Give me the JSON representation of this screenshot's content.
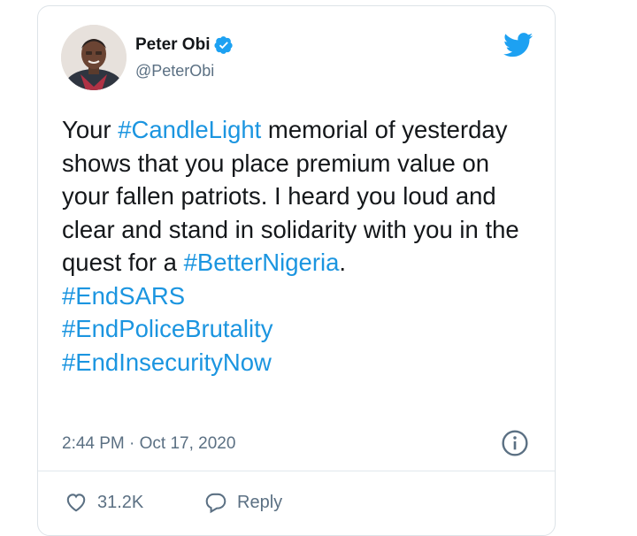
{
  "tweet": {
    "author_name": "Peter Obi",
    "author_handle": "@PeterObi",
    "text_segments": [
      {
        "text": "Your ",
        "type": "text"
      },
      {
        "text": "#CandleLight",
        "type": "hashtag"
      },
      {
        "text": " memorial of yesterday shows that you place premium value on your fallen patriots. I heard you loud and clear and stand in solidarity with you in the quest for a ",
        "type": "text"
      },
      {
        "text": "#BetterNigeria",
        "type": "hashtag"
      },
      {
        "text": ".",
        "type": "text"
      }
    ],
    "hashtag_lines": [
      "#EndSARS",
      "#EndPoliceBrutality",
      "#EndInsecurityNow"
    ],
    "timestamp": "2:44 PM · Oct 17, 2020",
    "like_count": "31.2K",
    "reply_label": "Reply"
  },
  "colors": {
    "link": "#1b95e0",
    "text": "#14171a",
    "muted": "#5b7083",
    "twitter_blue": "#1da1f2"
  },
  "icons": [
    "verified-badge-icon",
    "twitter-bird-icon",
    "info-icon",
    "heart-icon",
    "reply-bubble-icon"
  ]
}
